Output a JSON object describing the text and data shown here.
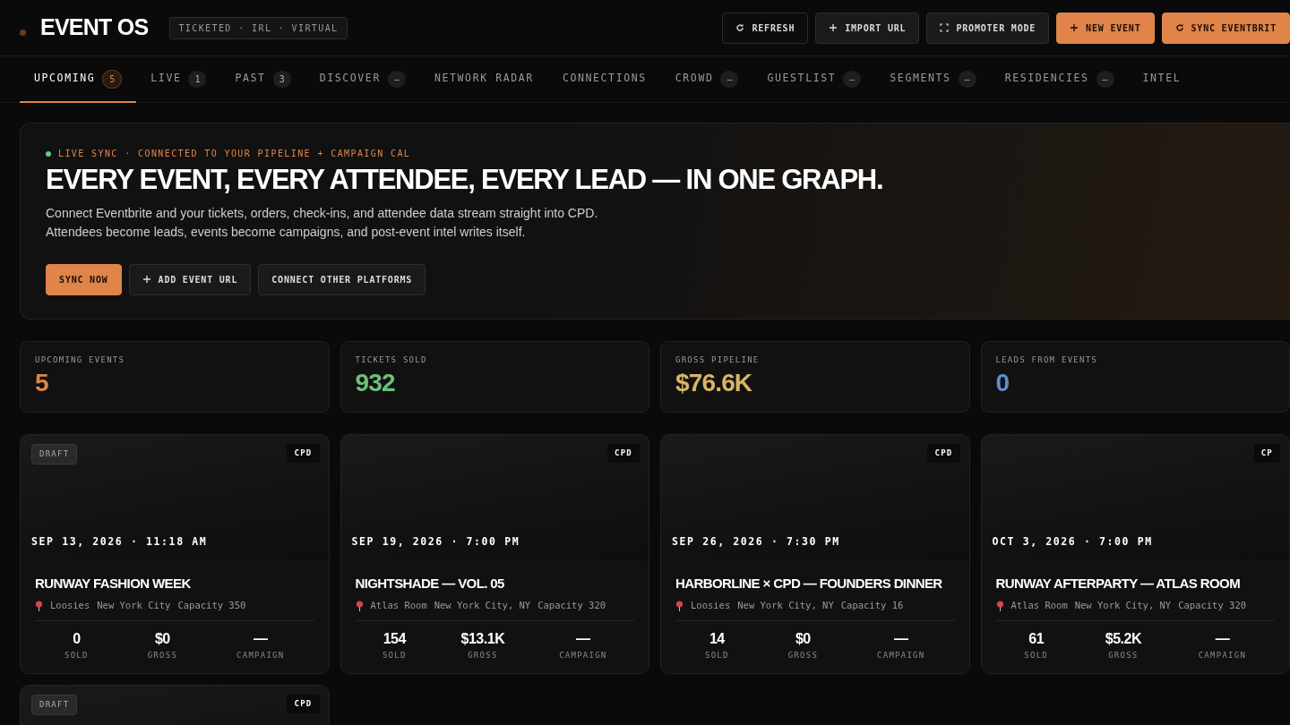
{
  "brand": {
    "title": "EVENT OS",
    "tag": "TICKETED · IRL · VIRTUAL"
  },
  "header_buttons": [
    {
      "label": "REFRESH",
      "kind": "dark"
    },
    {
      "label": "IMPORT URL",
      "kind": "ghost"
    },
    {
      "label": "PROMOTER MODE",
      "kind": "ghost"
    },
    {
      "label": "NEW EVENT",
      "kind": "primary"
    },
    {
      "label": "SYNC EVENTBRIT",
      "kind": "primary"
    }
  ],
  "tabs": [
    {
      "label": "UPCOMING",
      "count": "5",
      "selected": true
    },
    {
      "label": "LIVE",
      "count": "1",
      "selected": false
    },
    {
      "label": "PAST",
      "count": "3",
      "selected": false
    },
    {
      "label": "DISCOVER",
      "count": "—",
      "selected": false
    },
    {
      "label": "NETWORK RADAR",
      "selected": false
    },
    {
      "label": "CONNECTIONS",
      "selected": false
    },
    {
      "label": "CROWD",
      "count": "—",
      "selected": false
    },
    {
      "label": "GUESTLIST",
      "count": "—",
      "selected": false
    },
    {
      "label": "SEGMENTS",
      "count": "—",
      "selected": false
    },
    {
      "label": "RESIDENCIES",
      "count": "—",
      "selected": false
    },
    {
      "label": "INTEL",
      "selected": false
    }
  ],
  "hero": {
    "status": "LIVE SYNC · CONNECTED TO YOUR PIPELINE + CAMPAIGN CAL",
    "live": true,
    "title": "EVERY EVENT, EVERY ATTENDEE, EVERY LEAD — IN ONE GRAPH.",
    "body": "Connect Eventbrite and your tickets, orders, check-ins, and attendee data stream straight into CPD. Attendees become leads, events become campaigns, and post-event intel writes itself.",
    "buttons": [
      {
        "label": "SYNC NOW",
        "kind": "primary"
      },
      {
        "label": "ADD EVENT URL",
        "kind": "ghost"
      },
      {
        "label": "CONNECT OTHER PLATFORMS",
        "kind": "ghost"
      }
    ]
  },
  "stats": [
    {
      "label": "UPCOMING EVENTS",
      "value": "5",
      "color": "#e0844a"
    },
    {
      "label": "TICKETS SOLD",
      "value": "932",
      "color": "#6cc07a"
    },
    {
      "label": "GROSS PIPELINE",
      "value": "$76.6K",
      "color": "#d8b46a"
    },
    {
      "label": "LEADS FROM EVENTS",
      "value": "0",
      "color": "#5b8fd0"
    }
  ],
  "events": [
    {
      "status": "DRAFT",
      "source": "CPD",
      "date": "SEP 13, 2026 · 11:18 AM",
      "title": "RUNWAY FASHION WEEK",
      "venue": "Loosies",
      "city": "New York City",
      "capacity": "Capacity 350",
      "metrics": [
        {
          "value": "0",
          "label": "SOLD"
        },
        {
          "value": "$0",
          "label": "GROSS"
        },
        {
          "value": "—",
          "label": "CAMPAIGN"
        }
      ]
    },
    {
      "source": "CPD",
      "date": "SEP 19, 2026 · 7:00 PM",
      "title": "NIGHTSHADE — VOL. 05",
      "venue": "Atlas Room",
      "city": "New York City, NY",
      "capacity": "Capacity 320",
      "metrics": [
        {
          "value": "154",
          "label": "SOLD"
        },
        {
          "value": "$13.1K",
          "label": "GROSS"
        },
        {
          "value": "—",
          "label": "CAMPAIGN"
        }
      ]
    },
    {
      "source": "CPD",
      "date": "SEP 26, 2026 · 7:30 PM",
      "title": "HARBORLINE × CPD — FOUNDERS DINNER",
      "venue": "Loosies",
      "city": "New York City, NY",
      "capacity": "Capacity 16",
      "metrics": [
        {
          "value": "14",
          "label": "SOLD"
        },
        {
          "value": "$0",
          "label": "GROSS"
        },
        {
          "value": "—",
          "label": "CAMPAIGN"
        }
      ]
    },
    {
      "source": "CP",
      "date": "OCT 3, 2026 · 7:00 PM",
      "title": "RUNWAY AFTERPARTY — ATLAS ROOM",
      "venue": "Atlas Room",
      "city": "New York City, NY",
      "capacity": "Capacity 320",
      "metrics": [
        {
          "value": "61",
          "label": "SOLD"
        },
        {
          "value": "$5.2K",
          "label": "GROSS"
        },
        {
          "value": "—",
          "label": "CAMPAIGN"
        }
      ]
    },
    {
      "status": "DRAFT",
      "source": "CPD"
    }
  ]
}
